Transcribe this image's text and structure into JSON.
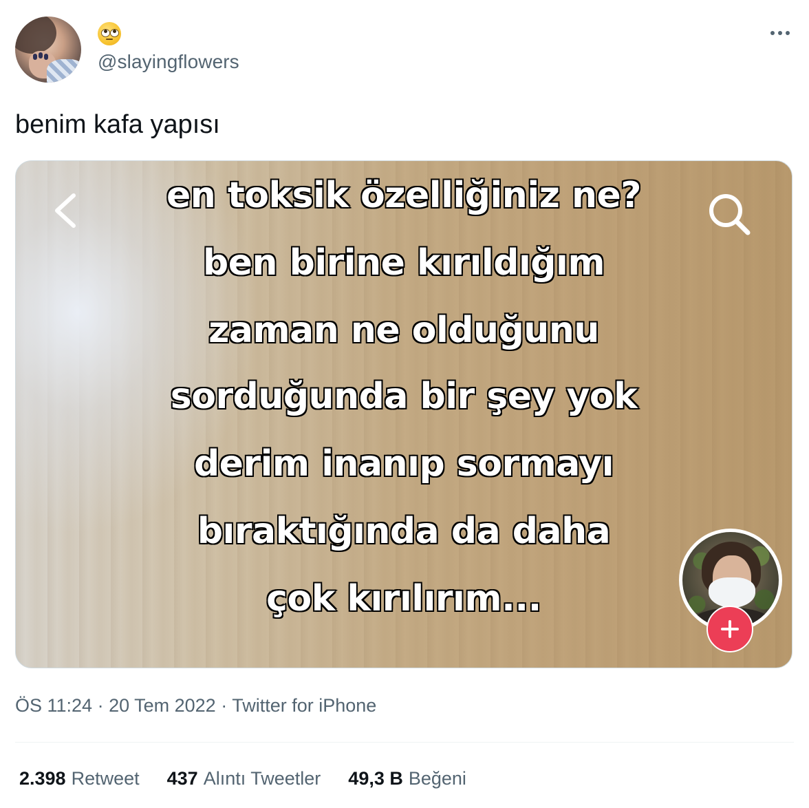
{
  "author": {
    "handle": "@slayingflowers",
    "display_name_icon": "face-with-rolling-eyes-icon"
  },
  "tweet": {
    "text": "benim kafa yapısı"
  },
  "media": {
    "caption_lines": [
      "en toksik özelliğiniz ne?",
      "ben birine kırıldığım",
      "zaman ne olduğunu",
      "sorduğunda bir şey yok",
      "derim inanıp sormayı",
      "bıraktığında da daha",
      "çok kırılırım..."
    ],
    "icons": [
      "back-chevron-icon",
      "search-icon",
      "plus-icon"
    ]
  },
  "meta": {
    "time": "ÖS 11:24",
    "separator": " · ",
    "date": "20 Tem 2022",
    "source": "Twitter for iPhone"
  },
  "stats": {
    "retweets": {
      "count": "2.398",
      "label": "Retweet"
    },
    "quotes": {
      "count": "437",
      "label": "Alıntı Tweetler"
    },
    "likes": {
      "count": "49,3 B",
      "label": "Beğeni"
    }
  },
  "colors": {
    "primary_text": "#0f1419",
    "secondary_text": "#536471",
    "divider": "#eff3f4",
    "plus_button": "#ec3e56"
  }
}
